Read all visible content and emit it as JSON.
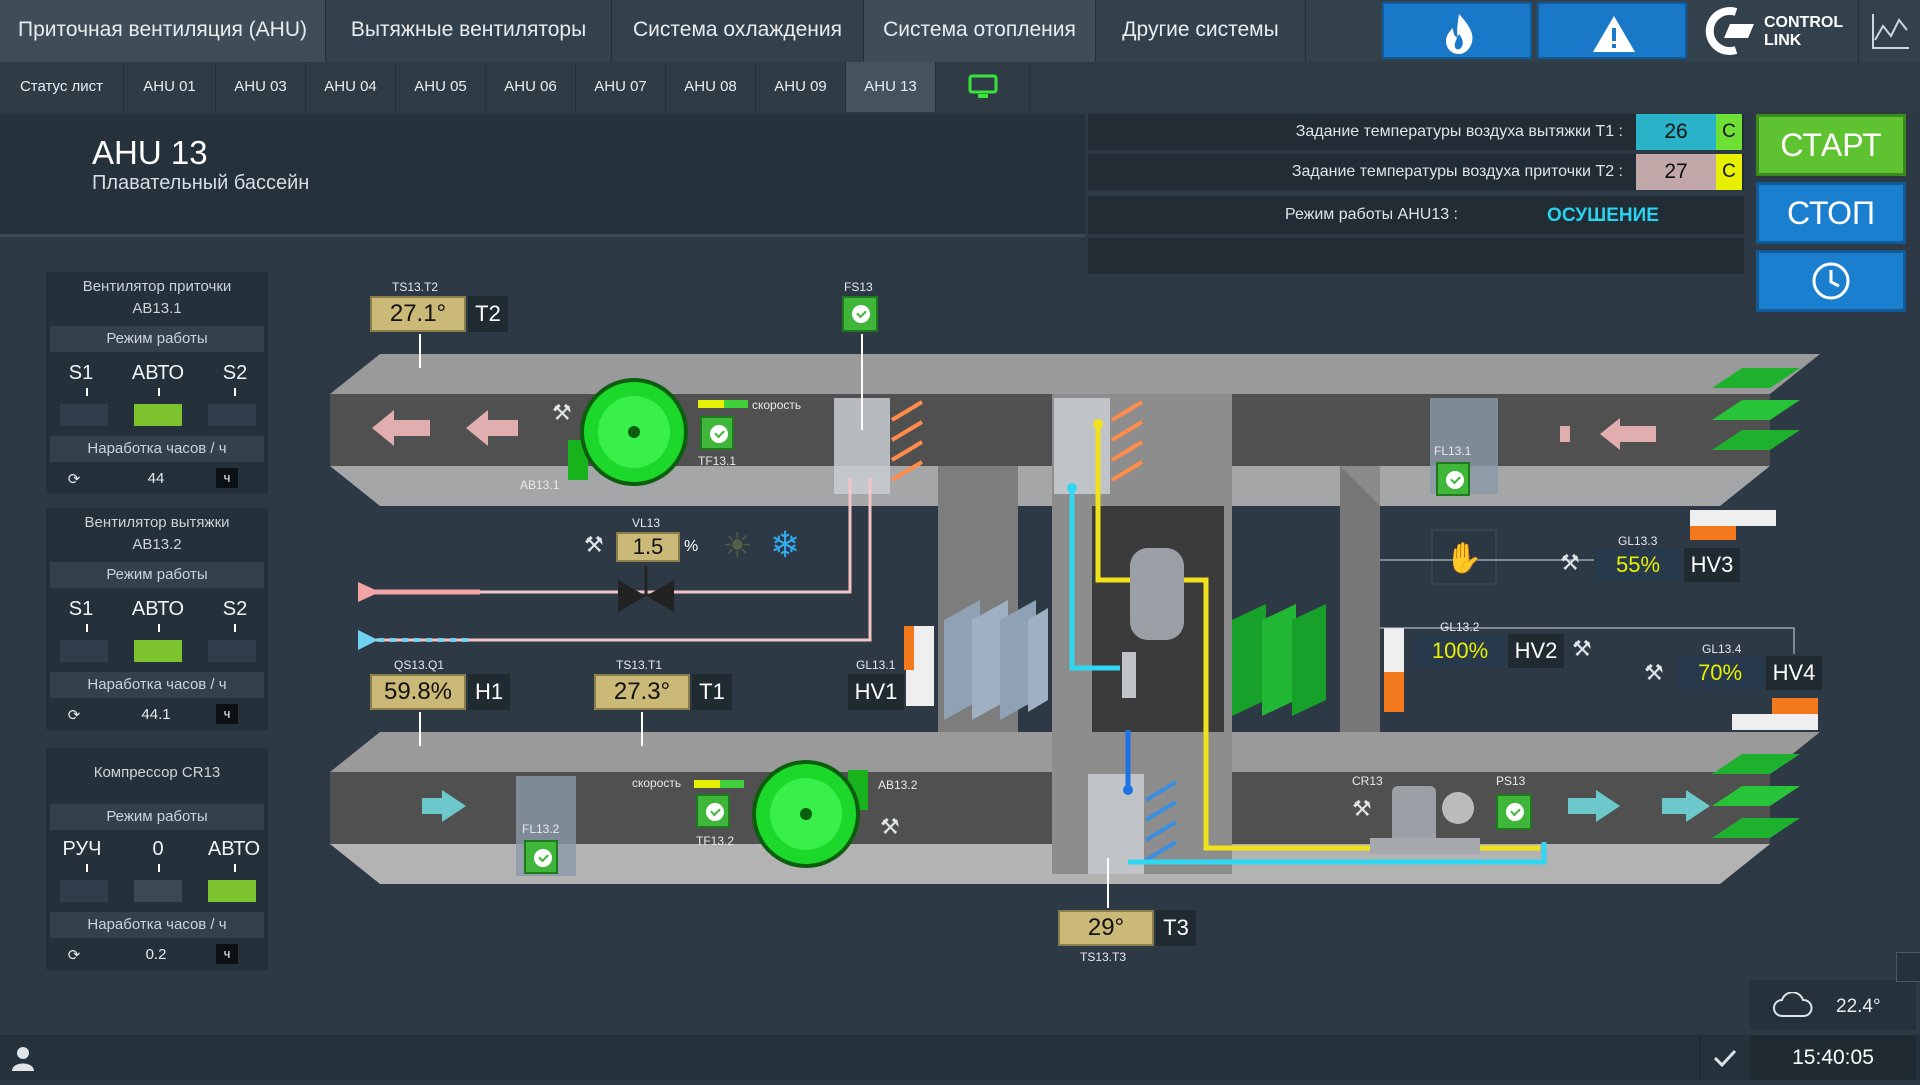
{
  "nav": {
    "tabs": [
      {
        "label": "Приточная вентиляция (AHU)",
        "active": true
      },
      {
        "label": "Вытяжные вентиляторы",
        "active": false
      },
      {
        "label": "Система охлаждения",
        "active": false
      },
      {
        "label": "Система отопления",
        "active": true
      },
      {
        "label": "Другие системы",
        "active": false
      }
    ],
    "icons": [
      "flame-icon",
      "warning-icon"
    ],
    "logo_line1": "CONTROL",
    "logo_line2": "LINK"
  },
  "subnav": {
    "tabs": [
      "Статус лист",
      "AHU 01",
      "AHU 03",
      "AHU 04",
      "AHU 05",
      "AHU 06",
      "AHU 07",
      "AHU 08",
      "AHU 09",
      "AHU 13"
    ],
    "active": "AHU 13"
  },
  "header": {
    "title": "AHU 13",
    "subtitle": "Плавательный бассейн"
  },
  "settings": {
    "t1_label": "Задание температуры воздуха вытяжки T1 :",
    "t1_value": "26",
    "t1_unit": "C",
    "t2_label": "Задание температуры воздуха приточки T2 :",
    "t2_value": "27",
    "t2_unit": "C",
    "mode_label": "Режим работы AHU13 :",
    "mode_value": "ОСУШЕНИЕ"
  },
  "controls": {
    "start_label": "СТАРТ",
    "stop_label": "СТОП"
  },
  "panels": [
    {
      "title1": "Вентилятор приточки",
      "title2": "АВ13.1",
      "mode_label": "Режим работы",
      "modes": [
        "S1",
        "АВТО",
        "S2"
      ],
      "active_mode": 1,
      "hours_label": "Наработка часов / ч",
      "hours": "44",
      "unit": "ч"
    },
    {
      "title1": "Вентилятор вытяжки",
      "title2": "АВ13.2",
      "mode_label": "Режим работы",
      "modes": [
        "S1",
        "АВТО",
        "S2"
      ],
      "active_mode": 1,
      "hours_label": "Наработка часов / ч",
      "hours": "44.1",
      "unit": "ч"
    },
    {
      "title1": "Компрессор CR13",
      "title2": "",
      "mode_label": "Режим работы",
      "modes": [
        "РУЧ",
        "0",
        "АВТО"
      ],
      "active_mode": 2,
      "hours_label": "Наработка часов / ч",
      "hours": "0.2",
      "unit": "ч"
    }
  ],
  "diagram": {
    "t2": {
      "label": "TS13.T2",
      "value": "27.1°",
      "tag": "T2"
    },
    "t1": {
      "label": "TS13.T1",
      "value": "27.3°",
      "tag": "T1"
    },
    "t3": {
      "label": "TS13.T3",
      "value": "29°",
      "tag": "T3"
    },
    "h1": {
      "label": "QS13.Q1",
      "value": "59.8%",
      "tag": "H1"
    },
    "fs13": "FS13",
    "vl13": {
      "label": "VL13",
      "value": "1.5",
      "unit": "%"
    },
    "fan_supply": {
      "label": "АВ13.1",
      "status": "TF13.1",
      "speed": "скорость"
    },
    "fan_exhaust": {
      "label": "АВ13.2",
      "status": "TF13.2",
      "speed": "скорость"
    },
    "fl131": "FL13.1",
    "fl132": "FL13.2",
    "hv1": {
      "label": "GL13.1",
      "tag": "HV1"
    },
    "hv2": {
      "label": "GL13.2",
      "value": "100%",
      "tag": "HV2"
    },
    "hv3": {
      "label": "GL13.3",
      "value": "55%",
      "tag": "HV3"
    },
    "hv4": {
      "label": "GL13.4",
      "value": "70%",
      "tag": "HV4"
    },
    "cr13": "CR13",
    "ps13": "PS13"
  },
  "status": {
    "outside_temp": "22.4°",
    "time": "15:40:05"
  }
}
